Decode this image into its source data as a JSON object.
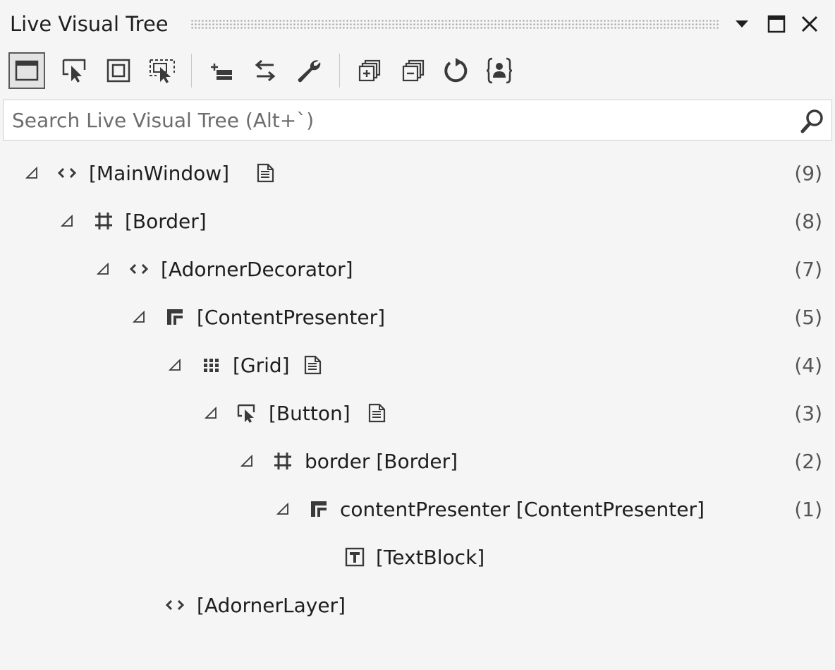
{
  "window": {
    "title": "Live Visual Tree"
  },
  "toolbar": {
    "buttons": [
      {
        "icon": "show-adorners-icon",
        "active": true
      },
      {
        "icon": "select-element-icon",
        "active": false
      },
      {
        "icon": "display-layout-adorners-icon",
        "active": false
      },
      {
        "icon": "track-focused-element-icon",
        "active": false
      },
      {
        "icon": "just-my-xaml-icon",
        "active": false
      },
      {
        "icon": "track-active-element-icon",
        "active": false
      },
      {
        "icon": "settings-wrench-icon",
        "active": false
      },
      {
        "icon": "expand-all-icon",
        "active": false
      },
      {
        "icon": "collapse-all-icon",
        "active": false
      },
      {
        "icon": "refresh-icon",
        "active": false
      },
      {
        "icon": "show-properties-icon",
        "active": false
      }
    ]
  },
  "search": {
    "placeholder": "Search Live Visual Tree (Alt+`)",
    "value": ""
  },
  "tree": {
    "nodes": [
      {
        "label": "[MainWindow]",
        "icon": "xaml-element-icon",
        "expanded": true,
        "has_source": true,
        "count": "(9)",
        "depth": 0
      },
      {
        "label": "[Border]",
        "icon": "border-icon",
        "expanded": true,
        "has_source": false,
        "count": "(8)",
        "depth": 1
      },
      {
        "label": "[AdornerDecorator]",
        "icon": "xaml-element-icon",
        "expanded": true,
        "has_source": false,
        "count": "(7)",
        "depth": 2
      },
      {
        "label": "[ContentPresenter]",
        "icon": "content-presenter-icon",
        "expanded": true,
        "has_source": false,
        "count": "(5)",
        "depth": 3
      },
      {
        "label": "[Grid]",
        "icon": "grid-icon",
        "expanded": true,
        "has_source": true,
        "count": "(4)",
        "depth": 4
      },
      {
        "label": "[Button]",
        "icon": "button-icon",
        "expanded": true,
        "has_source": true,
        "count": "(3)",
        "depth": 5
      },
      {
        "label": "border [Border]",
        "icon": "border-icon",
        "expanded": true,
        "has_source": false,
        "count": "(2)",
        "depth": 6
      },
      {
        "label": "contentPresenter [ContentPresenter]",
        "icon": "content-presenter-icon",
        "expanded": true,
        "has_source": false,
        "count": "(1)",
        "depth": 7
      },
      {
        "label": "[TextBlock]",
        "icon": "textblock-icon",
        "expanded": false,
        "has_source": false,
        "count": "",
        "depth": 8
      },
      {
        "label": "[AdornerLayer]",
        "icon": "xaml-element-icon",
        "expanded": false,
        "has_source": false,
        "count": "",
        "depth": 4
      }
    ]
  }
}
